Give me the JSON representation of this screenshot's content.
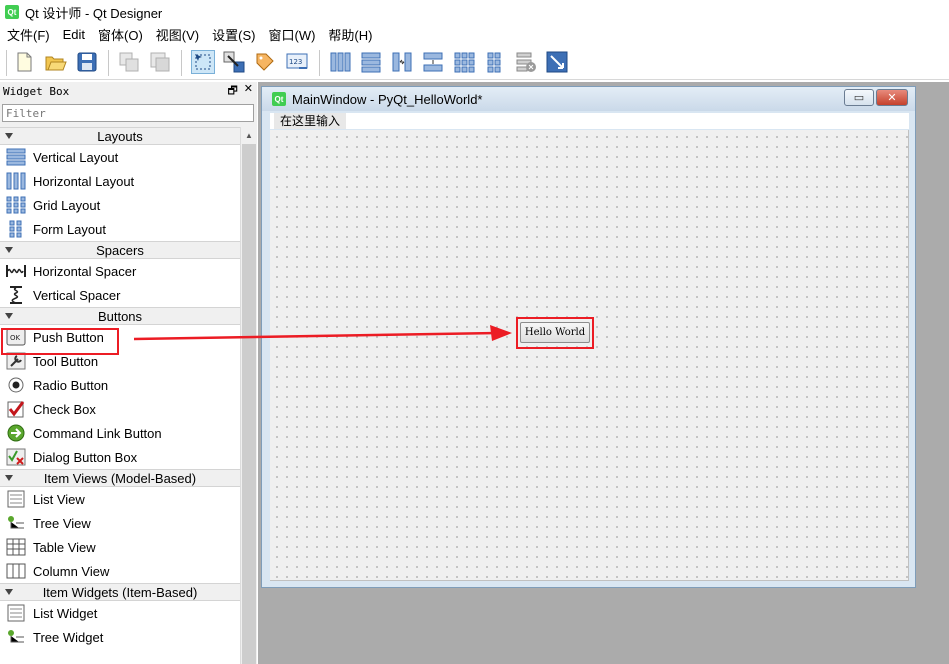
{
  "app": {
    "title": "Qt 设计师 - Qt Designer",
    "logo_text": "Qt"
  },
  "menubar": {
    "items": [
      "文件(F)",
      "Edit",
      "窗体(O)",
      "视图(V)",
      "设置(S)",
      "窗口(W)",
      "帮助(H)"
    ]
  },
  "toolbar": {
    "buttons": [
      "new-file-icon",
      "open-folder-icon",
      "save-icon",
      "copy-icon",
      "paste-icon",
      "widget-editing-mode-icon",
      "signal-slot-mode-icon",
      "buddy-mode-icon",
      "tab-order-mode-icon",
      "horizontal-layout-icon",
      "vertical-layout-icon",
      "horizontal-splitter-icon",
      "vertical-splitter-icon",
      "grid-layout-icon",
      "form-layout-icon",
      "break-layout-icon",
      "adjust-size-icon"
    ]
  },
  "widget_box": {
    "title": "Widget Box",
    "float_glyph": "🗗",
    "close_glyph": "✕",
    "filter_placeholder": "Filter",
    "categories": {
      "layouts": {
        "label": "Layouts",
        "items": [
          "Vertical Layout",
          "Horizontal Layout",
          "Grid Layout",
          "Form Layout"
        ]
      },
      "spacers": {
        "label": "Spacers",
        "items": [
          "Horizontal Spacer",
          "Vertical Spacer"
        ]
      },
      "buttons": {
        "label": "Buttons",
        "items": [
          "Push Button",
          "Tool Button",
          "Radio Button",
          "Check Box",
          "Command Link Button",
          "Dialog Button Box"
        ]
      },
      "item_views": {
        "label": "Item Views (Model-Based)",
        "items": [
          "List View",
          "Tree View",
          "Table View",
          "Column View"
        ]
      },
      "item_widgets": {
        "label": "Item Widgets (Item-Based)",
        "items": [
          "List Widget",
          "Tree Widget"
        ]
      }
    },
    "push_button_icon_text": "OK"
  },
  "form_window": {
    "title": "MainWindow - PyQt_HelloWorld*",
    "logo_text": "Qt",
    "minimize_glyph": "▭",
    "close_glyph": "✕",
    "menu_placeholder": "在这里输入",
    "hello_button_label": "Hello World"
  },
  "colors": {
    "annotation": "#ec1c24",
    "qt_green": "#41cd52"
  }
}
